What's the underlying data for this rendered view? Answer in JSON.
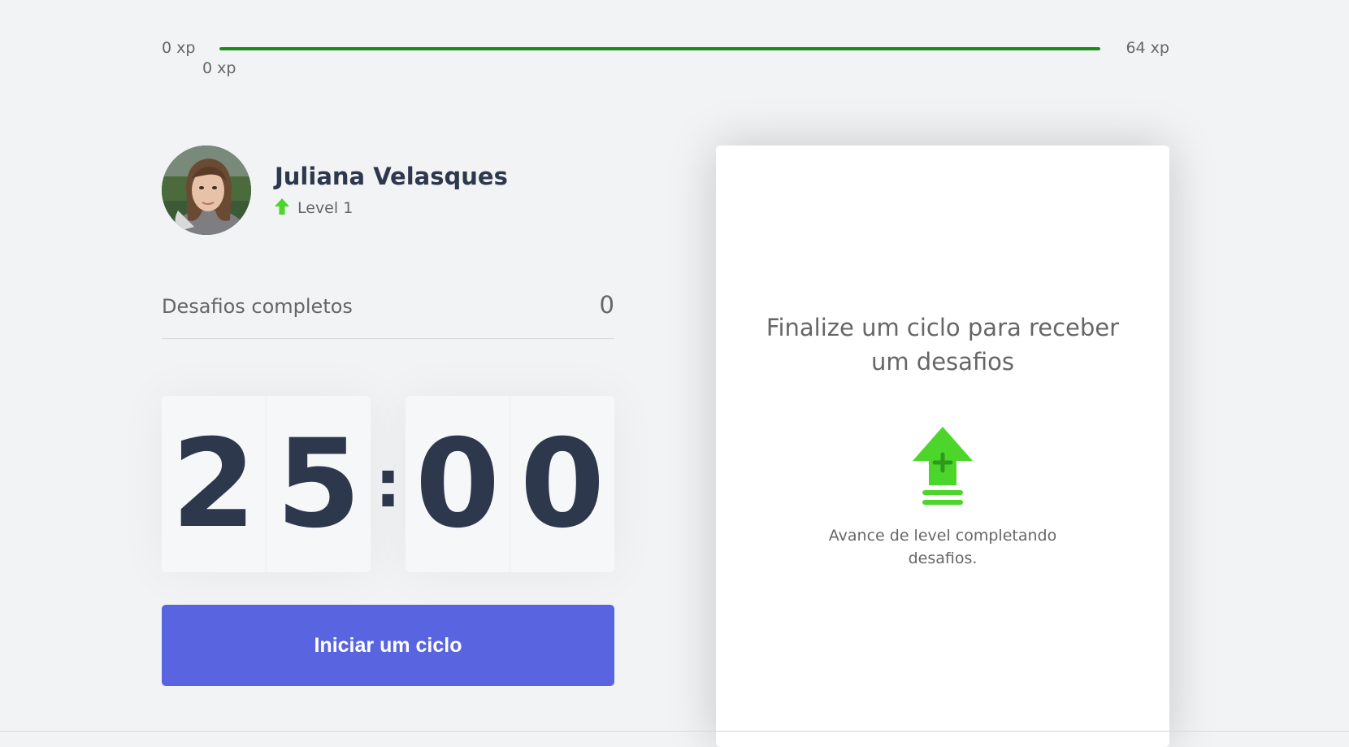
{
  "xp_bar": {
    "min_label": "0 xp",
    "max_label": "64 xp",
    "current_label": "0 xp",
    "fill_percent": 100,
    "fill_color": "#1a8a1a"
  },
  "profile": {
    "name": "Juliana Velasques",
    "level_label": "Level 1",
    "level_icon": "level-up-arrow-icon",
    "accent_color": "#4cd62b"
  },
  "challenges": {
    "label": "Desafios completos",
    "count": "0"
  },
  "countdown": {
    "minute_left": "2",
    "minute_right": "5",
    "separator": ":",
    "second_left": "0",
    "second_right": "0"
  },
  "start_button": {
    "label": "Iniciar um ciclo",
    "color": "#5965e0"
  },
  "challenge_card": {
    "title": "Finalize um ciclo para receber um desafios",
    "icon": "level-up-icon",
    "description": "Avance de level completando desafios."
  }
}
